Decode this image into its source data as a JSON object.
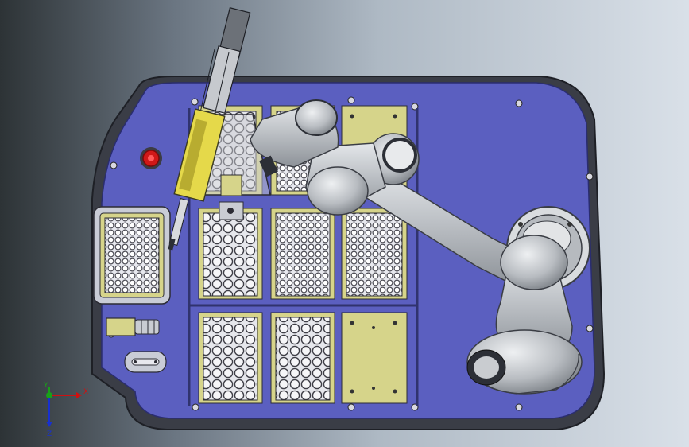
{
  "triad": {
    "x_label": "X",
    "y_label": "Y",
    "z_label": "Z",
    "x_color": "#d01010",
    "y_color": "#18a018",
    "z_color": "#1830d0"
  },
  "colors": {
    "deck": "#5b5fc0",
    "frame": "#4a4d58",
    "plate_yellow": "#d6d48a",
    "robot_silver": "#c4c8cc",
    "estop": "#d01818"
  },
  "components": {
    "deck": "robot-workbench-deck",
    "robot": "collaborative-robot-arm",
    "estop": "emergency-stop-button",
    "pipette": "pipette-end-effector"
  }
}
